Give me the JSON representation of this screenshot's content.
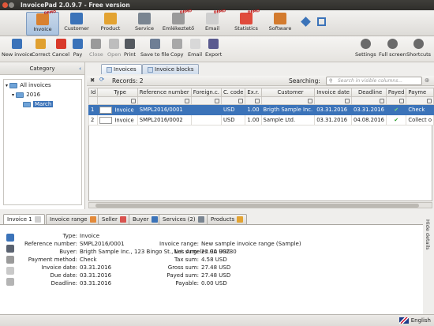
{
  "window": {
    "title": "InvoicePad 2.0.9.7 - Free version"
  },
  "nav": [
    {
      "label": "Invoice",
      "icon": "invoice-icon",
      "color": "#d9812f",
      "active": true,
      "demo": "DEMO"
    },
    {
      "label": "Customer",
      "icon": "customer-icon",
      "color": "#3b73b9"
    },
    {
      "label": "Product",
      "icon": "product-icon",
      "color": "#e3a332"
    },
    {
      "label": "Service",
      "icon": "service-icon",
      "color": "#7a8591"
    },
    {
      "label": "Emlékeztető",
      "icon": "reminder-icon",
      "color": "#9a9a9a",
      "demo": "DEMO"
    },
    {
      "label": "Email",
      "icon": "email-icon",
      "color": "#cfcfcf",
      "demo": "DEMO"
    },
    {
      "label": "Statistics",
      "icon": "statistics-icon",
      "color": "#e04b3c",
      "demo": "DEMO"
    },
    {
      "label": "Software",
      "icon": "software-icon",
      "color": "#d37b2e"
    }
  ],
  "toolbar": {
    "left": [
      {
        "label": "New invoice",
        "icon": "plus-icon",
        "color": "#3b73b9"
      },
      {
        "label": "Correct",
        "icon": "pencil-icon",
        "color": "#e0a030"
      },
      {
        "label": "Cancel",
        "icon": "cancel-icon",
        "color": "#d93a2b"
      },
      {
        "label": "Pay",
        "icon": "pay-icon",
        "color": "#3b73b9"
      },
      {
        "label": "Close",
        "icon": "lock-icon",
        "color": "#9a9a9a",
        "disabled": true
      },
      {
        "label": "Open",
        "icon": "open-icon",
        "color": "#bdbdbd",
        "disabled": true
      },
      {
        "label": "Print",
        "icon": "print-icon",
        "color": "#555a60"
      },
      {
        "label": "Save to file",
        "icon": "save-icon",
        "color": "#6f7f95"
      },
      {
        "label": "Copy",
        "icon": "copy-icon",
        "color": "#a8a8a8"
      },
      {
        "label": "Email",
        "icon": "email-send-icon",
        "color": "#d8d8d8"
      },
      {
        "label": "Export",
        "icon": "export-icon",
        "color": "#5b5b8f"
      }
    ],
    "right": [
      {
        "label": "Settings",
        "icon": "settings-icon",
        "color": "#6a6a6a"
      },
      {
        "label": "Full screen",
        "icon": "fullscreen-icon",
        "color": "#6a6a6a"
      },
      {
        "label": "Shortcuts",
        "icon": "shortcuts-icon",
        "color": "#6a6a6a"
      }
    ]
  },
  "sidebar": {
    "title": "Category",
    "tree": [
      {
        "label": "All invoices",
        "selected": false
      },
      {
        "label": "2016",
        "selected": false
      },
      {
        "label": "March",
        "selected": true
      }
    ]
  },
  "tabs": [
    {
      "label": "Invoices",
      "active": true
    },
    {
      "label": "Invoice blocks",
      "active": false
    }
  ],
  "filterbar": {
    "records": "Records: 2",
    "search_label": "Searching:",
    "search_placeholder": "Search in visible columns..."
  },
  "columns": [
    "Id",
    "Type",
    "Reference number",
    "Foreign.c.",
    "C. code",
    "Ex.r.",
    "Customer",
    "Invoice date",
    "Deadline",
    "Payed",
    "Payme"
  ],
  "rows": [
    {
      "id": "1",
      "type": "Invoice",
      "ref": "SMPL2016/0001",
      "foreign": "",
      "ccode": "USD",
      "exr": "1.00",
      "customer": "Brigth Sample Inc.",
      "date": "03.31.2016",
      "deadline": "03.31.2016",
      "payed": "✔",
      "payment": "Check",
      "selected": true
    },
    {
      "id": "2",
      "type": "Invoice",
      "ref": "SMPL2016/0002",
      "foreign": "",
      "ccode": "USD",
      "exr": "1.00",
      "customer": "Sample Ltd.",
      "date": "03.31.2016",
      "deadline": "04.08.2016",
      "payed": "✔",
      "payment": "Collect o",
      "selected": false
    }
  ],
  "bottom_tabs": [
    {
      "label": "Invoice 1",
      "active": true
    },
    {
      "label": "Invoice range"
    },
    {
      "label": "Seller"
    },
    {
      "label": "Buyer"
    },
    {
      "label": "Services (2)"
    },
    {
      "label": "Products"
    }
  ],
  "details_left": [
    {
      "key": "Type:",
      "value": "Invoice"
    },
    {
      "key": "Reference number:",
      "value": "SMPL2016/0001"
    },
    {
      "key": "Buyer:",
      "value": "Brigth Sample Inc., 123 Bingo St., Los Angeles CA 90230"
    },
    {
      "key": "Payment method:",
      "value": "Check"
    },
    {
      "key": "Invoice date:",
      "value": "03.31.2016"
    },
    {
      "key": "Due date:",
      "value": "03.31.2016"
    },
    {
      "key": "Deadline:",
      "value": "03.31.2016"
    }
  ],
  "details_right": [
    {
      "key": "Invoice range:",
      "value": "New sample invoice range (Sample)"
    },
    {
      "key": "Net sum:",
      "value": "22.90 USD"
    },
    {
      "key": "Tax sum:",
      "value": "4.58 USD"
    },
    {
      "key": "Gross sum:",
      "value": "27.48 USD"
    },
    {
      "key": "Payed sum:",
      "value": "27.48 USD"
    },
    {
      "key": "Payable:",
      "value": "0.00 USD"
    }
  ],
  "hide_details": "Hide details",
  "status": {
    "language": "English"
  }
}
